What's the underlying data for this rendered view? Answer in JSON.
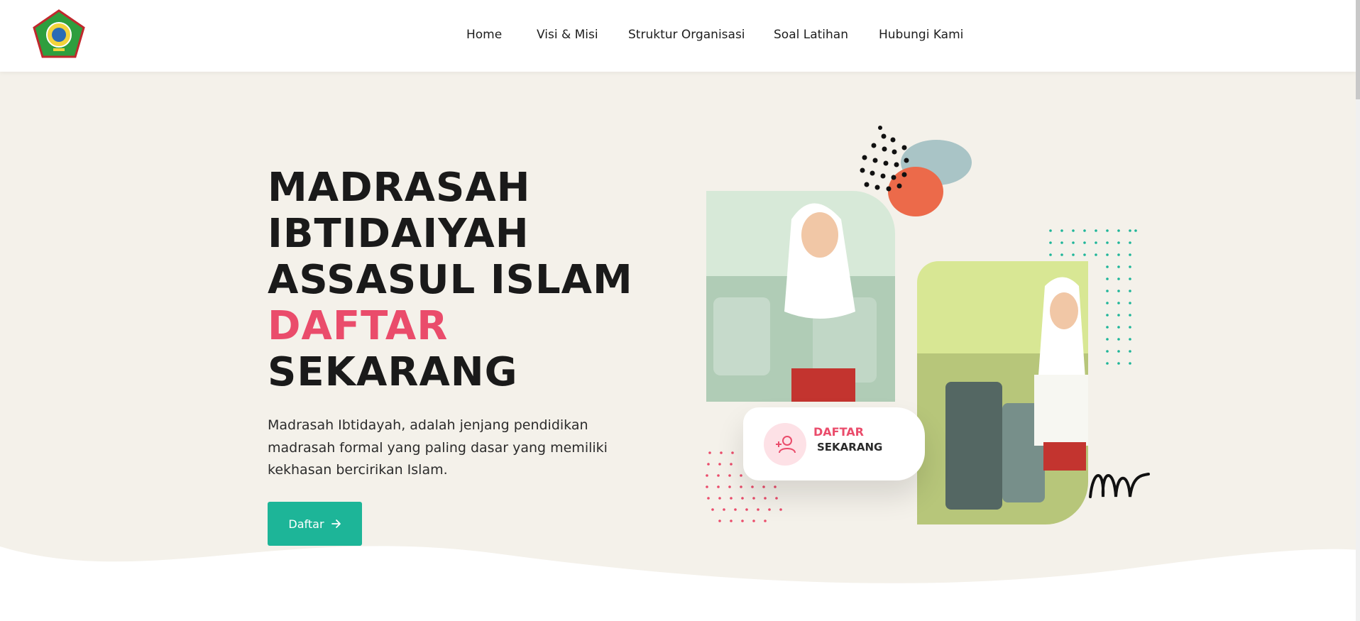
{
  "nav": {
    "items": [
      {
        "label": "Home"
      },
      {
        "label": "Visi & Misi"
      },
      {
        "label": "Struktur Organisasi"
      },
      {
        "label": "Soal Latihan"
      },
      {
        "label": "Hubungi Kami"
      }
    ]
  },
  "hero": {
    "title_line1": "MADRASAH",
    "title_line2": "IBTIDAIYAH",
    "title_line3": "ASSASUL ISLAM",
    "title_accent": "DAFTAR",
    "title_line5": "SEKARANG",
    "description": "Madrasah Ibtidayah, adalah jenjang pendidikan madrasah formal yang paling dasar yang memiliki kekhasan bercirikan Islam.",
    "cta_label": "Daftar"
  },
  "card": {
    "line1": "DAFTAR",
    "line2": "SEKARANG"
  },
  "colors": {
    "accent": "#ea4c6b",
    "primary": "#1db598",
    "background": "#f4f1ea"
  },
  "icons": {
    "logo": "school-crest",
    "cta": "arrow-right-icon",
    "card": "user-plus-icon"
  }
}
